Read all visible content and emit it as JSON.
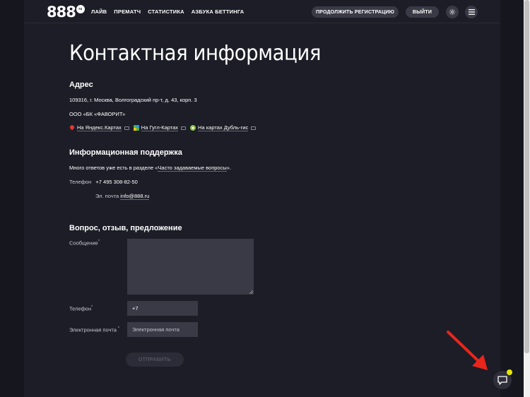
{
  "header": {
    "logo_text": "888",
    "logo_badge": "ru",
    "nav": [
      "ЛАЙВ",
      "ПРЕМАТЧ",
      "СТАТИСТИКА",
      "АЗБУКА БЕТТИНГА"
    ],
    "continue_registration": "ПРОДОЛЖИТЬ РЕГИСТРАЦИЮ",
    "logout": "ВЫЙТИ",
    "settings_icon": "gear-icon",
    "menu_icon": "hamburger-icon"
  },
  "page": {
    "title": "Контактная информация"
  },
  "address": {
    "heading": "Адрес",
    "line": "109316, г. Москва, Волгоградский пр-т, д. 43, корп. 3",
    "company": "ООО «БК «ФАВОРИТ»",
    "maps": [
      {
        "label": "На Яндекс.Картах",
        "color": "#e53935"
      },
      {
        "label": "На Гугл-Картах",
        "color": "#4caf50"
      },
      {
        "label": "На картах Дубль-гис",
        "color": "#8bc34a"
      }
    ]
  },
  "support": {
    "heading": "Информационная поддержка",
    "faq_prefix": "Много ответов уже есть в разделе «",
    "faq_link": "Часто задаваемые вопросы",
    "faq_suffix": "».",
    "phone_label": "Телефон",
    "phone_value": "+7 495 308-82-50",
    "email_label": "Эл. почта",
    "email_value": "info@888.ru"
  },
  "form": {
    "heading": "Вопрос, отзыв, предложение",
    "message_label": "Сообщение",
    "phone_label": "Телефон",
    "phone_value": "+7",
    "email_label": "Электронная почта",
    "email_placeholder": "Электронная почта",
    "required_mark": "*",
    "submit_label": "ОТПРАВИТЬ"
  },
  "colors": {
    "background": "#1d1d27",
    "input_bg": "#3a3a46",
    "chat_indicator": "#e6e600",
    "annotation_arrow": "#e8261c"
  }
}
